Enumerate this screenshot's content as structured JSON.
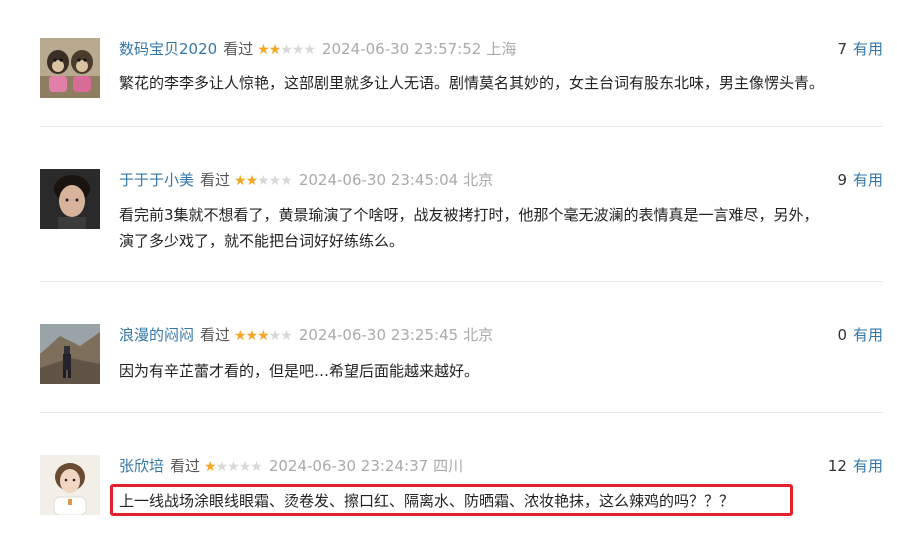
{
  "comments": [
    {
      "user": "数码宝贝2020",
      "status": "看过",
      "rating": 2,
      "time": "2024-06-30 23:57:52",
      "location": "上海",
      "votes": "7",
      "useful_label": "有用",
      "text": "繁花的李李多让人惊艳，这部剧里就多让人无语。剧情莫名其妙的，女主台词有股东北味，男主像愣头青。"
    },
    {
      "user": "于于于小美",
      "status": "看过",
      "rating": 2,
      "time": "2024-06-30 23:45:04",
      "location": "北京",
      "votes": "9",
      "useful_label": "有用",
      "text_line1": "看完前3集就不想看了，黄景瑜演了个啥呀，战友被拷打时，他那个毫无波澜的表情真是一言难尽，另外，",
      "text_line2": "演了多少戏了，就不能把台词好好练练么。"
    },
    {
      "user": "浪漫的闷闷",
      "status": "看过",
      "rating": 3,
      "time": "2024-06-30 23:25:45",
      "location": "北京",
      "votes": "0",
      "useful_label": "有用",
      "text": "因为有辛芷蕾才看的，但是吧…希望后面能越来越好。"
    },
    {
      "user": "张欣培",
      "status": "看过",
      "rating": 1,
      "time": "2024-06-30 23:24:37",
      "location": "四川",
      "votes": "12",
      "useful_label": "有用",
      "text": "上一线战场涂眼线眼霜、烫卷发、擦口红、隔离水、防晒霜、浓妆艳抹，这么辣鸡的吗？？？"
    }
  ],
  "colors": {
    "link": "#3377aa",
    "star_on": "#f5a623",
    "star_off": "#d8d8d8",
    "highlight": "#e5202a"
  }
}
